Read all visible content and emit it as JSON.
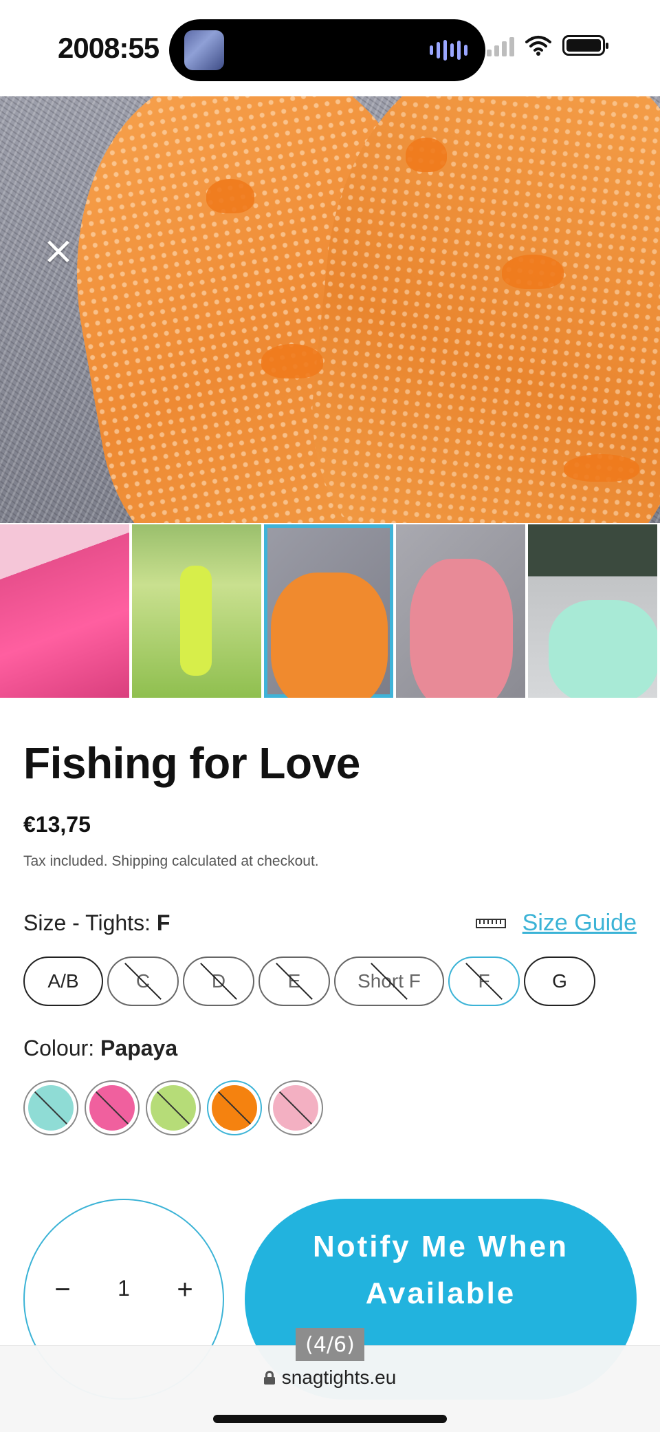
{
  "status_bar": {
    "time": "2008:55"
  },
  "product": {
    "title": "Fishing for Love",
    "price": "€13,75",
    "tax_note": "Tax included. Shipping calculated at checkout."
  },
  "size": {
    "label_prefix": "Size - Tights:",
    "selected_value": "F",
    "guide_label": "Size Guide",
    "options": [
      {
        "label": "A/B",
        "available": true,
        "selected": false
      },
      {
        "label": "C",
        "available": false,
        "selected": false
      },
      {
        "label": "D",
        "available": false,
        "selected": false
      },
      {
        "label": "E",
        "available": false,
        "selected": false
      },
      {
        "label": "Short F",
        "available": false,
        "selected": false
      },
      {
        "label": "F",
        "available": false,
        "selected": true
      },
      {
        "label": "G",
        "available": true,
        "selected": false
      }
    ]
  },
  "colour": {
    "label_prefix": "Colour:",
    "selected_value": "Papaya",
    "swatches": [
      {
        "color": "#8fdcd5",
        "selected": false,
        "available": false
      },
      {
        "color": "#f0609e",
        "selected": false,
        "available": false
      },
      {
        "color": "#b6dc78",
        "selected": false,
        "available": false
      },
      {
        "color": "#f5820f",
        "selected": true,
        "available": false
      },
      {
        "color": "#f3b0c2",
        "selected": false,
        "available": false
      }
    ]
  },
  "quantity": {
    "minus": "−",
    "value": "1",
    "plus": "+"
  },
  "cta": {
    "label": "Notify Me When Available"
  },
  "gallery": {
    "page_indicator": "(4/6)",
    "close_icon": "×"
  },
  "browser": {
    "url": "snagtights.eu"
  },
  "colors": {
    "accent": "#22b3de",
    "link": "#3bb3d6"
  }
}
